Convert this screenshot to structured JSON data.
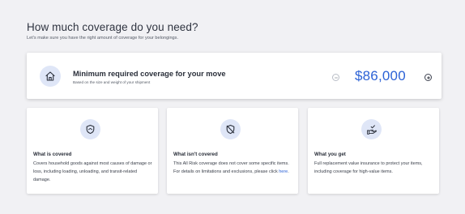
{
  "header": {
    "title": "How much coverage do you need?",
    "subtitle": "Let's make sure you have the right amount of coverage for your belongings."
  },
  "coverage": {
    "title": "Minimum required coverage for your move",
    "subtitle": "Based on the size and weight of your shipment",
    "amount": "$86,000",
    "icon": "home-icon",
    "controls": [
      "minus-icon",
      "plus-icon"
    ]
  },
  "cards": [
    {
      "icon": "shield-icon",
      "title": "What is covered",
      "body": "Covers household goods against most causes of damage or loss, including loading, unloading, and transit-related damage."
    },
    {
      "icon": "shield-off-icon",
      "title": "What isn't covered",
      "body_pre": "This All Risk coverage does not cover some specific items. For details on limitations and exclusions, please click ",
      "link": "here",
      "body_post": "."
    },
    {
      "icon": "hand-check-icon",
      "title": "What you get",
      "body": "Full replacement value insurance to protect your items, including coverage for high-value items."
    }
  ],
  "colors": {
    "accent": "#2c62d6",
    "icon_bg": "#dfe6f7",
    "page_bg": "#f1f1f4"
  }
}
